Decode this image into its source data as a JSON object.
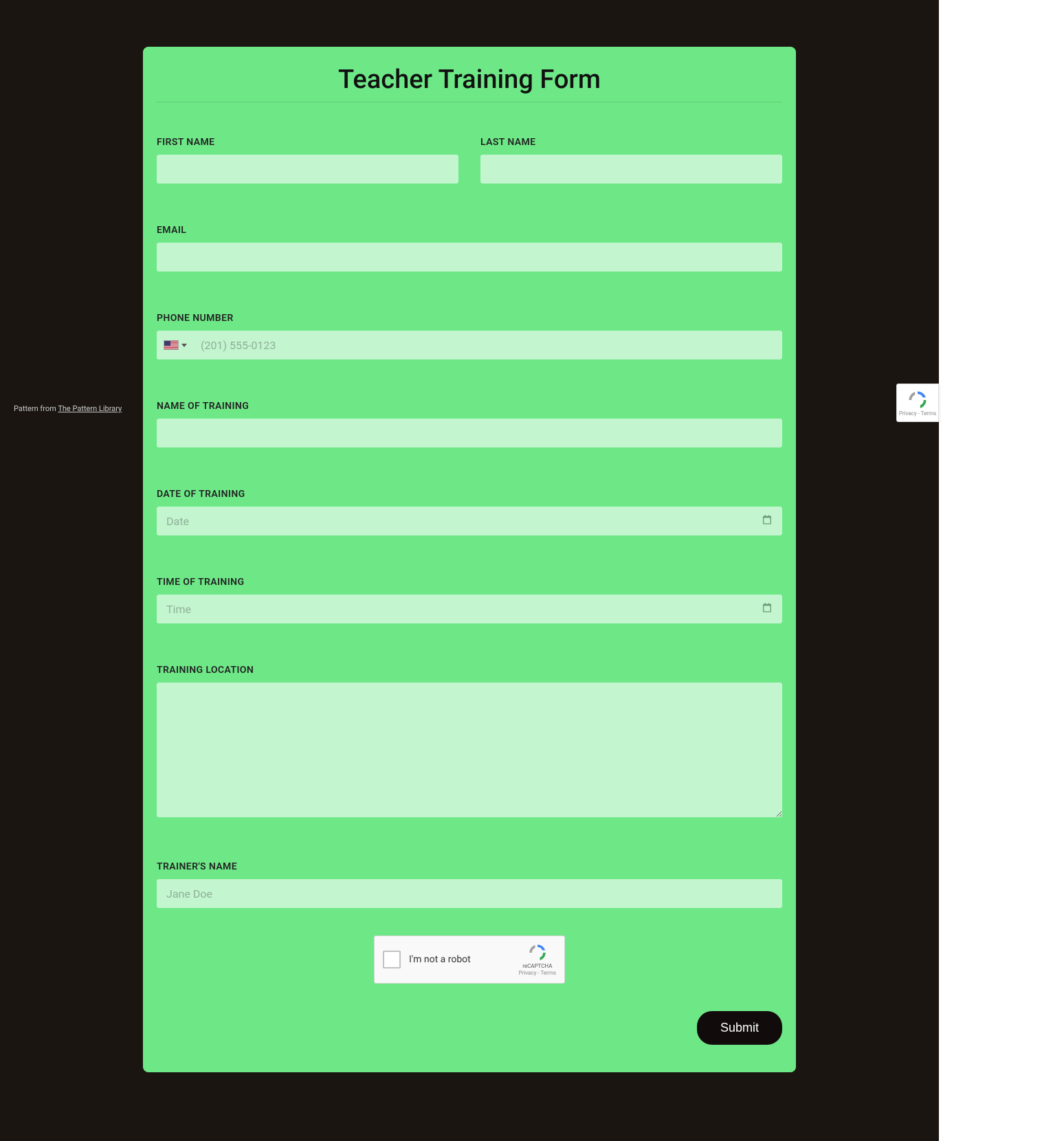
{
  "form": {
    "title": "Teacher Training Form",
    "fields": {
      "first_name": {
        "label": "FIRST NAME",
        "value": "",
        "placeholder": ""
      },
      "last_name": {
        "label": "LAST NAME",
        "value": "",
        "placeholder": ""
      },
      "email": {
        "label": "EMAIL",
        "value": "",
        "placeholder": ""
      },
      "phone": {
        "label": "PHONE NUMBER",
        "value": "",
        "placeholder": "(201) 555-0123",
        "country_flag": "us-flag"
      },
      "training_name": {
        "label": "NAME OF TRAINING",
        "value": "",
        "placeholder": ""
      },
      "training_date": {
        "label": "DATE OF TRAINING",
        "value": "",
        "placeholder": "Date"
      },
      "training_time": {
        "label": "TIME OF TRAINING",
        "value": "",
        "placeholder": "Time"
      },
      "training_location": {
        "label": "TRAINING LOCATION",
        "value": "",
        "placeholder": ""
      },
      "trainer_name": {
        "label": "TRAINER'S NAME",
        "value": "",
        "placeholder": "Jane Doe"
      }
    },
    "recaptcha": {
      "checkbox_label": "I'm not a robot",
      "brand": "reCAPTCHA",
      "legal": "Privacy - Terms"
    },
    "submit_label": "Submit"
  },
  "attribution": {
    "prefix": "Pattern from ",
    "link_text": "The Pattern Library"
  },
  "recaptcha_badge": {
    "legal": "Privacy - Terms"
  }
}
